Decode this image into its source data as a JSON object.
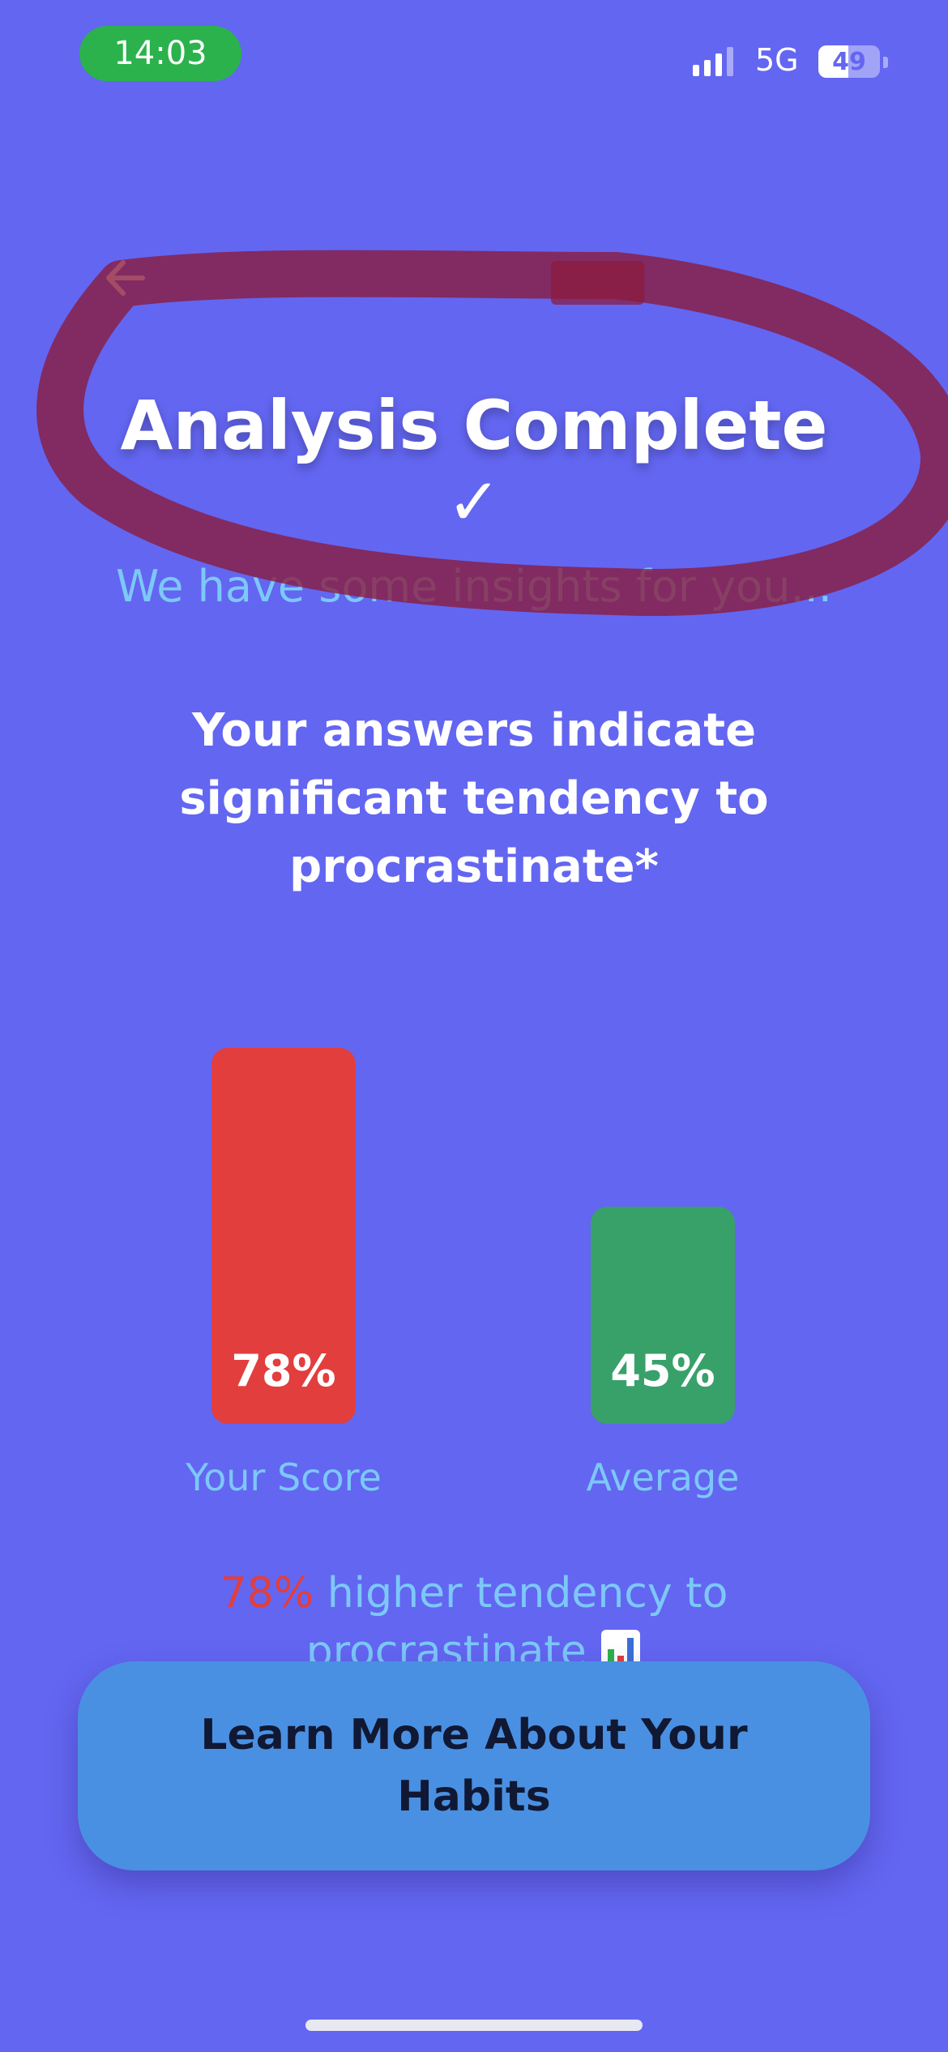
{
  "status_bar": {
    "time": "14:03",
    "network": "5G",
    "battery": "49",
    "battery_level": 0.49
  },
  "title": "Analysis Complete",
  "checkmark": "✓",
  "subtitle": "We have some insights for you...",
  "result_text": "Your answers indicate significant tendency to procrastinate*",
  "chart_data": {
    "type": "bar",
    "categories": [
      "Your Score",
      "Average"
    ],
    "values": [
      78,
      45
    ],
    "value_labels": [
      "78%",
      "45%"
    ],
    "colors": [
      "#E23E3E",
      "#38A169"
    ],
    "ylim": [
      0,
      100
    ]
  },
  "comparison": {
    "percent": "78%",
    "text": "higher tendency to procrastinate",
    "icon": "bar-chart-emoji"
  },
  "cta_label": "Learn More About Your Habits",
  "colors": {
    "background": "#6366F1",
    "accent": "#4A90E2",
    "highlight": "#7CC8F8",
    "annotation": "#8B1A3A"
  }
}
